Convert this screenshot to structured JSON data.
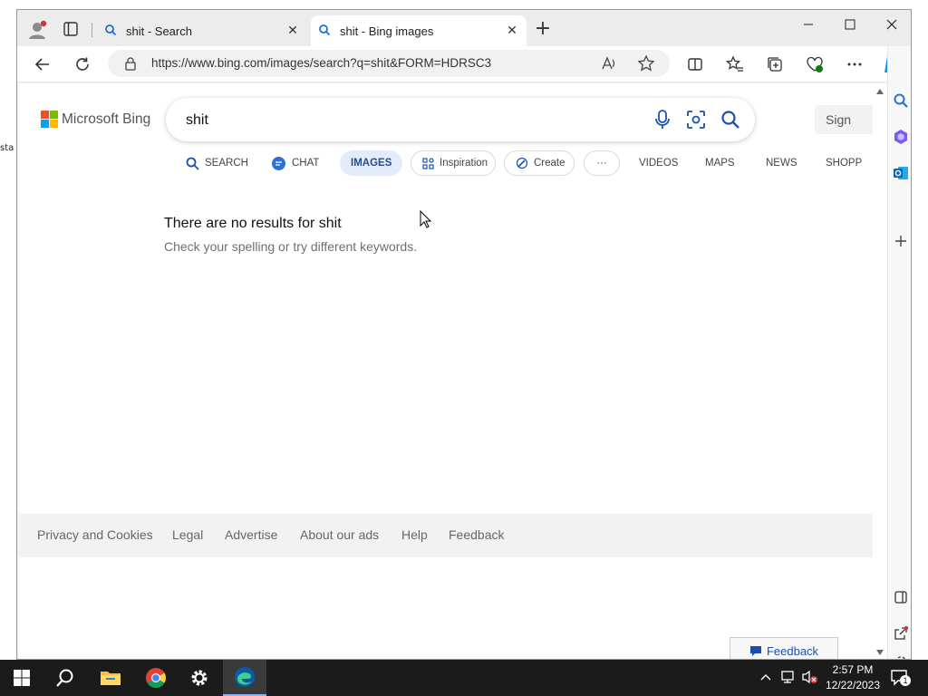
{
  "desktop": {
    "edge_text": "sta"
  },
  "browser": {
    "tabs": [
      {
        "title": "shit - Search",
        "close": "✕"
      },
      {
        "title": "shit - Bing images",
        "close": "✕"
      }
    ],
    "new_tab": "+",
    "address": "https://www.bing.com/images/search?q=shit&FORM=HDRSC3"
  },
  "bing": {
    "logo_text": "Microsoft Bing",
    "query": "shit",
    "sign_in": "Sign",
    "nav": {
      "search": "SEARCH",
      "chat": "CHAT",
      "images": "IMAGES",
      "inspiration": "Inspiration",
      "create": "Create",
      "more": "···",
      "videos": "VIDEOS",
      "maps": "MAPS",
      "news": "NEWS",
      "shopping": "SHOPP"
    },
    "no_results_title": "There are no results for shit",
    "no_results_hint": "Check your spelling or try different keywords.",
    "footer": [
      "Privacy and Cookies",
      "Legal",
      "Advertise",
      "About our ads",
      "Help",
      "Feedback"
    ],
    "feedback_button": "Feedback"
  },
  "taskbar": {
    "time": "2:57 PM",
    "date": "12/22/2023",
    "notifications": "1"
  },
  "colors": {
    "edge_blue": "#0c59a4",
    "bing_accent": "#1a4fb0",
    "active_pill": "#e3ecfb"
  }
}
